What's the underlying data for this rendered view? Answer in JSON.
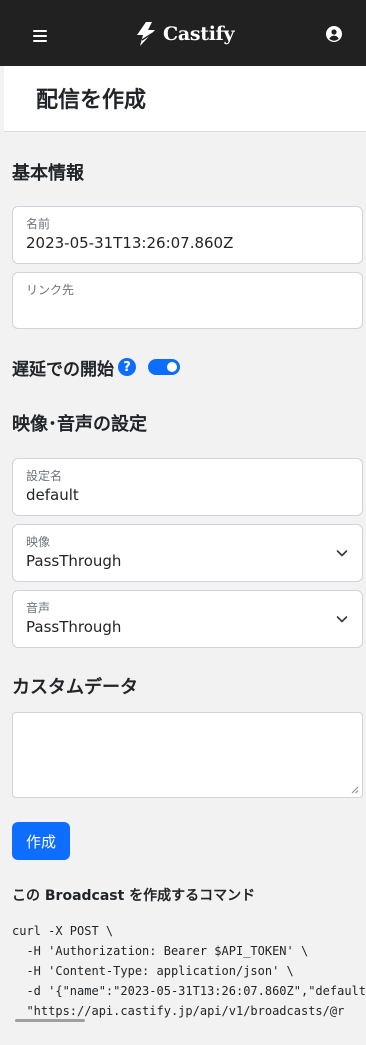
{
  "header": {
    "brand": "Castify",
    "menu_icon": "hamburger-icon",
    "account_icon": "user-circle-icon"
  },
  "page": {
    "title": "配信を作成"
  },
  "basic_info": {
    "heading": "基本情報",
    "name_field": {
      "label": "名前",
      "value": "2023-05-31T13:26:07.860Z"
    },
    "link_field": {
      "label": "リンク先",
      "value": ""
    }
  },
  "delayed_start": {
    "label": "遅延での開始",
    "help_icon": "question-circle-icon",
    "enabled": true
  },
  "av_settings": {
    "heading": "映像･音声の設定",
    "config_field": {
      "label": "設定名",
      "value": "default"
    },
    "video_field": {
      "label": "映像",
      "value": "PassThrough"
    },
    "audio_field": {
      "label": "音声",
      "value": "PassThrough"
    }
  },
  "custom_data": {
    "heading": "カスタムデータ",
    "value": ""
  },
  "actions": {
    "create_label": "作成"
  },
  "command": {
    "heading": "この Broadcast を作成するコマンド",
    "code": "curl -X POST \\\n  -H 'Authorization: Bearer $API_TOKEN' \\\n  -H 'Content-Type: application/json' \\\n  -d '{\"name\":\"2023-05-31T13:26:07.860Z\",\"default\n  \"https://api.castify.jp/api/v1/broadcasts/@r"
  },
  "colors": {
    "header_bg": "#212121",
    "primary": "#0d6efd",
    "page_bg": "#f2f2f2"
  }
}
